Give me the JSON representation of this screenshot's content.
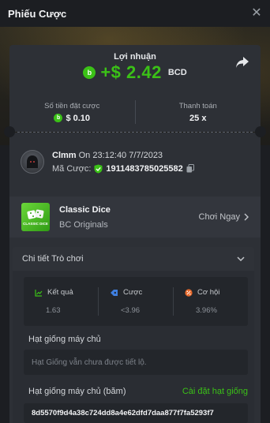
{
  "header": {
    "title": "Phiếu Cược"
  },
  "profit": {
    "label": "Lợi nhuận",
    "amount": "+$ 2.42",
    "currency": "BCD"
  },
  "summary": {
    "bet_amount_label": "Số tiền đặt cược",
    "bet_amount_value": "$ 0.10",
    "payout_label": "Thanh toán",
    "payout_value": "25 x"
  },
  "user": {
    "name": "Clmm",
    "time_text": "On 23:12:40 7/7/2023",
    "bet_id_label": "Mã Cược:",
    "bet_id": "1911483785025582"
  },
  "game": {
    "name": "Classic Dice",
    "provider": "BC Originals",
    "thumb_text": "CLASSIC DICE",
    "play_label": "Chơi Ngay"
  },
  "details": {
    "title": "Chi tiết Trò chơi",
    "stats": [
      {
        "label": "Kết quả",
        "value": "1.63"
      },
      {
        "label": "Cược",
        "value": "<3.96"
      },
      {
        "label": "Cơ hội",
        "value": "3.96%"
      }
    ],
    "server_seed_label": "Hạt giống máy chủ",
    "server_seed_placeholder": "Hạt Giống vẫn chưa được tiết lộ.",
    "server_seed_hash_label": "Hạt giống máy chủ (băm)",
    "set_seed_label": "Cài đặt hạt giống",
    "server_seed_hash": "8d5570f9d4a38c724dd8a4e62dfd7daa877f7fa5293f7"
  },
  "colors": {
    "accent": "#3bc117",
    "background": "#1c1e22",
    "card": "#2d3036"
  }
}
